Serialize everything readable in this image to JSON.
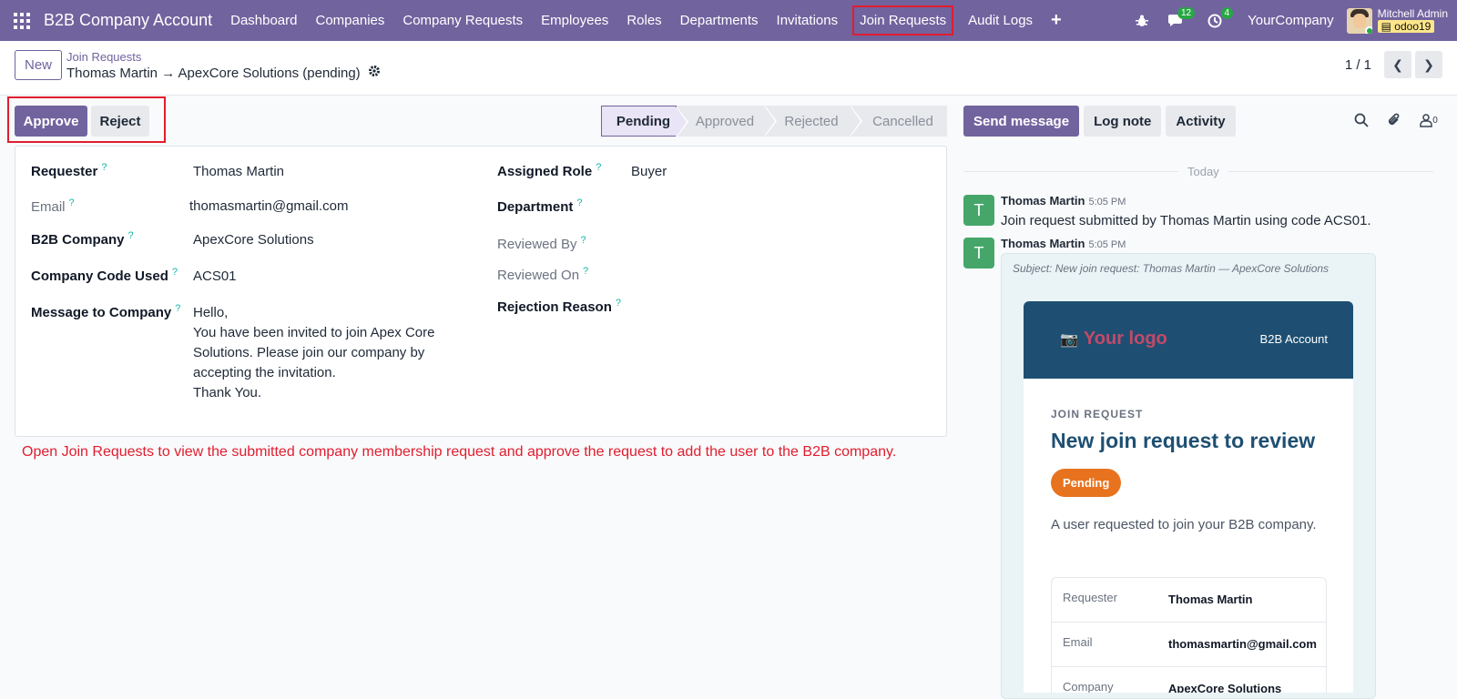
{
  "navbar": {
    "brand": "B2B Company Account",
    "menu": [
      {
        "label": "Dashboard"
      },
      {
        "label": "Companies"
      },
      {
        "label": "Company Requests"
      },
      {
        "label": "Employees"
      },
      {
        "label": "Roles"
      },
      {
        "label": "Departments"
      },
      {
        "label": "Invitations"
      },
      {
        "label": "Join Requests",
        "highlighted": true
      },
      {
        "label": "Audit Logs"
      }
    ],
    "plus": "+",
    "messages_count": "12",
    "activities_count": "4",
    "company": "YourCompany",
    "user_name": "Mitchell Admin",
    "db_name": "odoo19"
  },
  "control": {
    "new_label": "New",
    "breadcrumb": "Join Requests",
    "record_title": "Thomas Martin → ApexCore Solutions (pending)",
    "pager": "1 / 1"
  },
  "actions": {
    "approve": "Approve",
    "reject": "Reject"
  },
  "status": {
    "stages": [
      "Pending",
      "Approved",
      "Rejected",
      "Cancelled"
    ],
    "active": "Pending"
  },
  "form": {
    "requester_label": "Requester",
    "requester": "Thomas Martin",
    "email_label": "Email",
    "email": "thomasmartin@gmail.com",
    "company_label": "B2B Company",
    "company": "ApexCore Solutions",
    "code_label": "Company Code Used",
    "code": "ACS01",
    "message_label": "Message to Company",
    "message_lines": [
      "Hello,",
      "You have been invited to join Apex Core",
      "Solutions. Please join our company by",
      "accepting the invitation.",
      "Thank You."
    ],
    "role_label": "Assigned Role",
    "role": "Buyer",
    "department_label": "Department",
    "reviewed_by_label": "Reviewed By",
    "reviewed_on_label": "Reviewed On",
    "rejection_label": "Rejection Reason",
    "help_mark": "?"
  },
  "instruction": "Open Join Requests to view the submitted company membership request and approve the request to add the user to the B2B company.",
  "chatter": {
    "send_message": "Send message",
    "log_note": "Log note",
    "activity": "Activity",
    "followers_count": "0",
    "today": "Today",
    "messages": [
      {
        "avatar": "T",
        "author": "Thomas Martin",
        "time": "5:05 PM",
        "body": "Join request submitted by Thomas Martin using code ACS01."
      },
      {
        "avatar": "T",
        "author": "Thomas Martin",
        "time": "5:05 PM",
        "subject": "Subject: New join request: Thomas Martin — ApexCore Solutions"
      }
    ],
    "mail": {
      "logo": "Your logo",
      "account": "B2B Account",
      "kicker": "JOIN REQUEST",
      "heading": "New join request to review",
      "pill": "Pending",
      "text": "A user requested to join your B2B company.",
      "rows": [
        {
          "key": "Requester",
          "value": "Thomas Martin"
        },
        {
          "key": "Email",
          "value": "thomasmartin@gmail.com"
        },
        {
          "key": "Company",
          "value": "ApexCore Solutions"
        }
      ]
    }
  },
  "colors": {
    "brand": "#71639e",
    "highlight": "#e11d2f",
    "mail_header": "#1e4f72",
    "pill": "#e8731e",
    "avatar": "#46a66a"
  }
}
